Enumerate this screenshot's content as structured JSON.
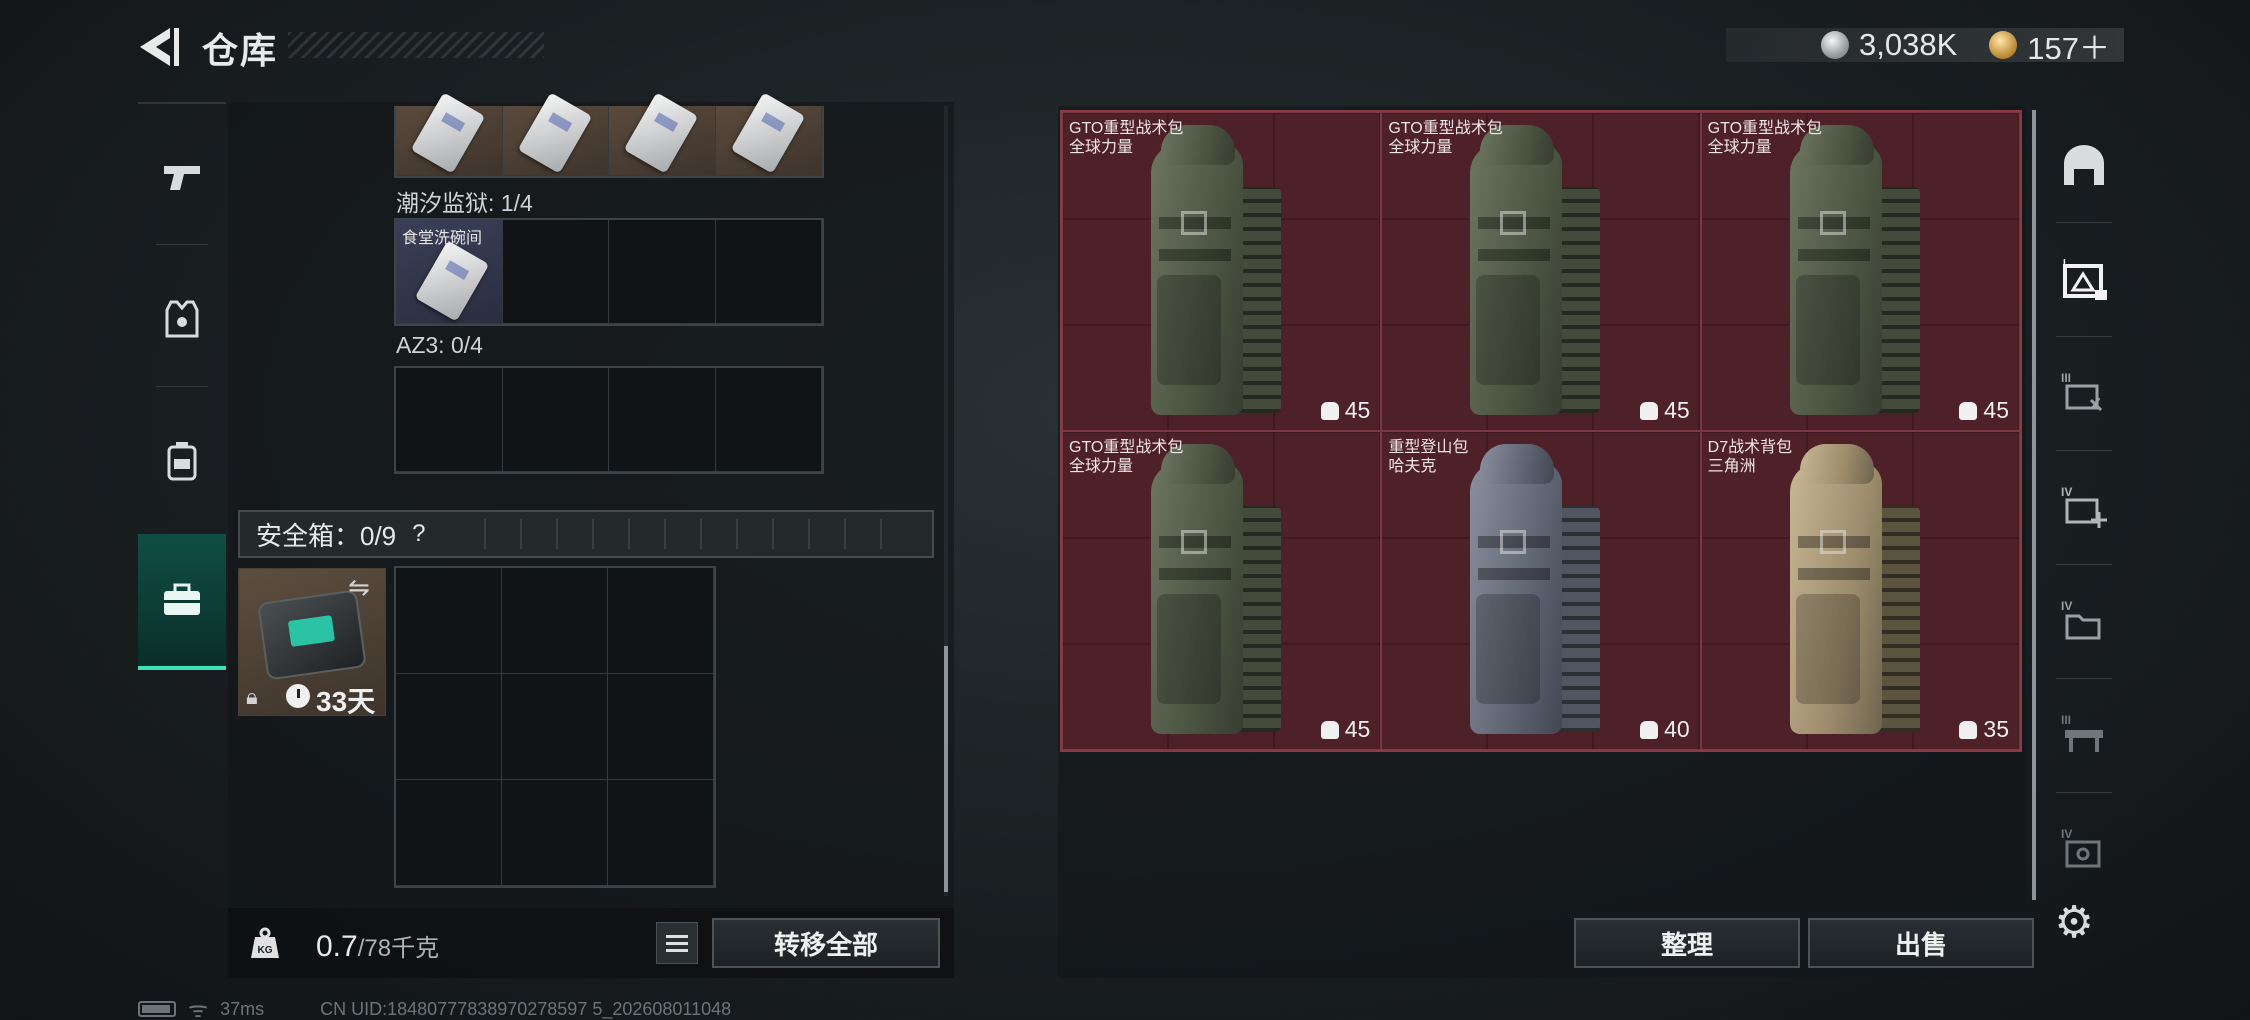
{
  "header": {
    "title": "仓库"
  },
  "currency": {
    "silver": "3,038K",
    "gold": "157＋"
  },
  "left_rail": [
    {
      "name": "weapon-category-icon"
    },
    {
      "name": "armor-category-icon"
    },
    {
      "name": "backpack-category-icon"
    },
    {
      "name": "safebox-category-icon",
      "active": true
    }
  ],
  "inventory": {
    "sections": [
      {
        "label": "潮汐监狱: 1/4",
        "cells": 4,
        "filled": 1,
        "filled_tag": "食堂洗碗间"
      },
      {
        "label": "AZ3: 0/4",
        "cells": 4,
        "filled": 0
      }
    ],
    "safebox": {
      "label": "安全箱：0/9",
      "help": "?",
      "days": "33天"
    },
    "weight": {
      "current": "0.7",
      "capacity": "/78千克"
    },
    "transfer_all": "转移全部"
  },
  "stash": {
    "items": [
      {
        "name_line1": "GTO重型战术包",
        "name_line2": "全球力量",
        "capacity": "45",
        "color": "olive"
      },
      {
        "name_line1": "GTO重型战术包",
        "name_line2": "全球力量",
        "capacity": "45",
        "color": "olive"
      },
      {
        "name_line1": "GTO重型战术包",
        "name_line2": "全球力量",
        "capacity": "45",
        "color": "olive"
      },
      {
        "name_line1": "GTO重型战术包",
        "name_line2": "全球力量",
        "capacity": "45",
        "color": "olive"
      },
      {
        "name_line1": "重型登山包",
        "name_line2": "哈夫克",
        "capacity": "40",
        "color": "gray"
      },
      {
        "name_line1": "D7战术背包",
        "name_line2": "三角洲",
        "capacity": "35",
        "color": "tan"
      }
    ],
    "sort_button": "整理",
    "sell_button": "出售"
  },
  "status_bar": {
    "ping": "37ms",
    "uid": "CN UID:18480777838970278597 5_202608011048"
  },
  "colors": {
    "accent": "#3de0b9",
    "stash_bg": "#4e2027",
    "stash_border": "#8a3a44"
  }
}
